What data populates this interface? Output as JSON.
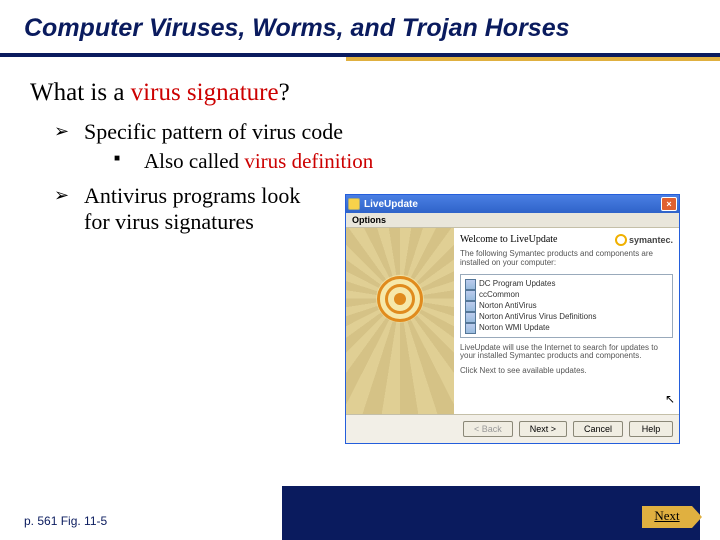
{
  "title": "Computer Viruses, Worms, and Trojan Horses",
  "question": {
    "prefix": "What is a ",
    "highlight": "virus signature",
    "suffix": "?"
  },
  "bullets": {
    "b1": "Specific pattern of virus code",
    "s1a": "Also called ",
    "s1b": "virus definition",
    "b2": "Antivirus programs look for virus signatures"
  },
  "dialog": {
    "title": "LiveUpdate",
    "options_label": "Options",
    "welcome": "Welcome to LiveUpdate",
    "brand": "symantec.",
    "intro": "The following Symantec products and components are installed on your computer:",
    "updates": [
      "DC Program Updates",
      "ccCommon",
      "Norton AntiVirus",
      "Norton AntiVirus Virus Definitions",
      "Norton WMI Update"
    ],
    "footer1": "LiveUpdate will use the Internet to search for updates to your installed Symantec products and components.",
    "footer2": "Click Next to see available updates.",
    "buttons": {
      "back": "< Back",
      "next": "Next >",
      "cancel": "Cancel",
      "help": "Help"
    }
  },
  "page_ref": "p. 561 Fig. 11-5",
  "next_label": "Next"
}
